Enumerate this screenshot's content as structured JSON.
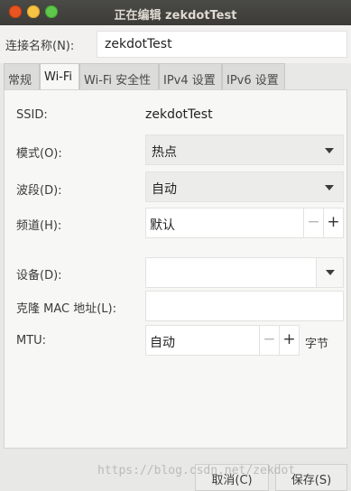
{
  "window": {
    "title": "正在编辑 zekdotTest"
  },
  "connection": {
    "name_label": "连接名称(N):",
    "name_value": "zekdotTest"
  },
  "tabs": [
    {
      "label": "常规"
    },
    {
      "label": "Wi-Fi"
    },
    {
      "label": "Wi-Fi 安全性"
    },
    {
      "label": "IPv4 设置"
    },
    {
      "label": "IPv6 设置"
    }
  ],
  "form": {
    "ssid_label": "SSID:",
    "ssid_value": "zekdotTest",
    "mode_label": "模式(O):",
    "mode_value": "热点",
    "band_label": "波段(D):",
    "band_value": "自动",
    "channel_label": "频道(H):",
    "channel_value": "默认",
    "device_label": "设备(D):",
    "device_value": "",
    "mac_label": "克隆 MAC 地址(L):",
    "mac_value": "",
    "mtu_label": "MTU:",
    "mtu_value": "自动",
    "mtu_unit": "字节",
    "minus_glyph": "−",
    "plus_glyph": "+"
  },
  "buttons": {
    "cancel": "取消(C)",
    "save": "保存(S)"
  },
  "watermark": "https://blog.csdn.net/zekdot"
}
